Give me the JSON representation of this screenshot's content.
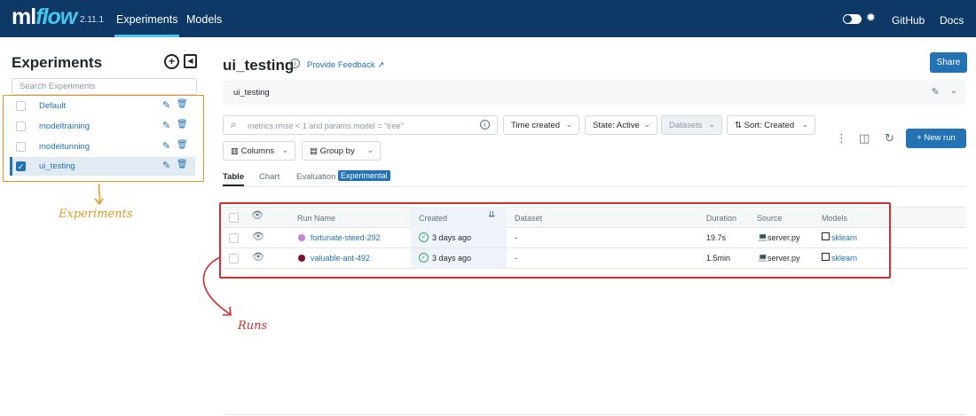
{
  "topbar": {
    "logo_ml": "ml",
    "logo_flow": "flow",
    "version": "2.11.1",
    "tabs": [
      {
        "label": "Experiments"
      },
      {
        "label": "Models"
      }
    ],
    "github": "GitHub",
    "docs": "Docs"
  },
  "sidebar": {
    "title": "Experiments",
    "search_placeholder": "Search Experiments",
    "items": [
      {
        "label": "Default",
        "checked": false
      },
      {
        "label": "modeltraining",
        "checked": false
      },
      {
        "label": "modeltunning",
        "checked": false
      },
      {
        "label": "ui_testing",
        "checked": true
      }
    ],
    "annotation": "Experiments"
  },
  "main": {
    "title": "ui_testing",
    "feedback": "Provide Feedback",
    "share": "Share",
    "description": "ui_testing",
    "search_placeholder": "metrics.rmse < 1 and params.model = \"tree\"",
    "filters": {
      "time": "Time created",
      "state": "State: Active",
      "datasets": "Datasets",
      "sort": "Sort: Created",
      "columns": "Columns",
      "group": "Group by"
    },
    "new_run": "+ New run",
    "tabs": [
      {
        "label": "Table"
      },
      {
        "label": "Chart"
      },
      {
        "label": "Evaluation"
      }
    ],
    "experimental_badge": "Experimental",
    "table": {
      "headers": {
        "run_name": "Run Name",
        "created": "Created",
        "dataset": "Dataset",
        "duration": "Duration",
        "source": "Source",
        "models": "Models"
      },
      "rows": [
        {
          "name": "fortunate-steed-292",
          "dot_color": "#c583d6",
          "created": "3 days ago",
          "dataset": "-",
          "duration": "19.7s",
          "source": "server.py",
          "model": "sklearn"
        },
        {
          "name": "valuable-ant-492",
          "dot_color": "#7a1230",
          "created": "3 days ago",
          "dataset": "-",
          "duration": "1.5min",
          "source": "server.py",
          "model": "sklearn"
        }
      ]
    },
    "annotation": "Runs"
  },
  "colors": {
    "nav": "#0e3966",
    "accent": "#2272b4",
    "annotation_orange": "#e8961d",
    "annotation_red": "#d32f2f"
  }
}
